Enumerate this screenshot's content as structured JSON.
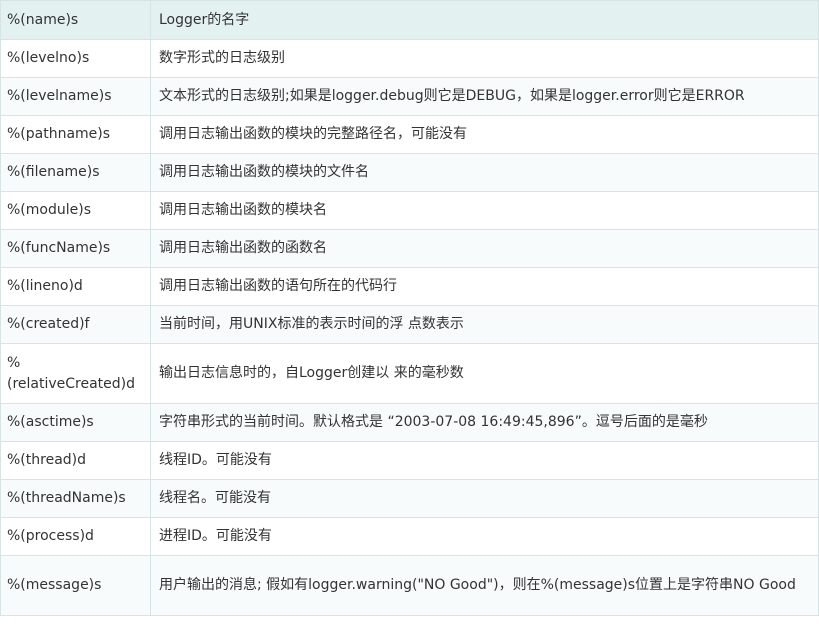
{
  "header": {
    "key": "%(name)s",
    "desc": "Logger的名字"
  },
  "rows": [
    {
      "key": "%(levelno)s",
      "desc": "数字形式的日志级别"
    },
    {
      "key": "%(levelname)s",
      "desc": "文本形式的日志级别;如果是logger.debug则它是DEBUG，如果是logger.error则它是ERROR"
    },
    {
      "key": "%(pathname)s",
      "desc": "调用日志输出函数的模块的完整路径名，可能没有"
    },
    {
      "key": "%(filename)s",
      "desc": "调用日志输出函数的模块的文件名"
    },
    {
      "key": "%(module)s",
      "desc": "调用日志输出函数的模块名"
    },
    {
      "key": "%(funcName)s",
      "desc": "调用日志输出函数的函数名"
    },
    {
      "key": "%(lineno)d",
      "desc": "调用日志输出函数的语句所在的代码行"
    },
    {
      "key": "%(created)f",
      "desc": "当前时间，用UNIX标准的表示时间的浮 点数表示"
    },
    {
      "key": "%(relativeCreated)d",
      "desc": "输出日志信息时的，自Logger创建以 来的毫秒数"
    },
    {
      "key": "%(asctime)s",
      "desc": "字符串形式的当前时间。默认格式是 “2003-07-08 16:49:45,896”。逗号后面的是毫秒"
    },
    {
      "key": "%(thread)d",
      "desc": "线程ID。可能没有"
    },
    {
      "key": "%(threadName)s",
      "desc": "线程名。可能没有"
    },
    {
      "key": "%(process)d",
      "desc": "进程ID。可能没有"
    },
    {
      "key": "%(message)s",
      "desc": "用户输出的消息; 假如有logger.warning(\"NO Good\")，则在%(message)s位置上是字符串NO Good"
    }
  ]
}
